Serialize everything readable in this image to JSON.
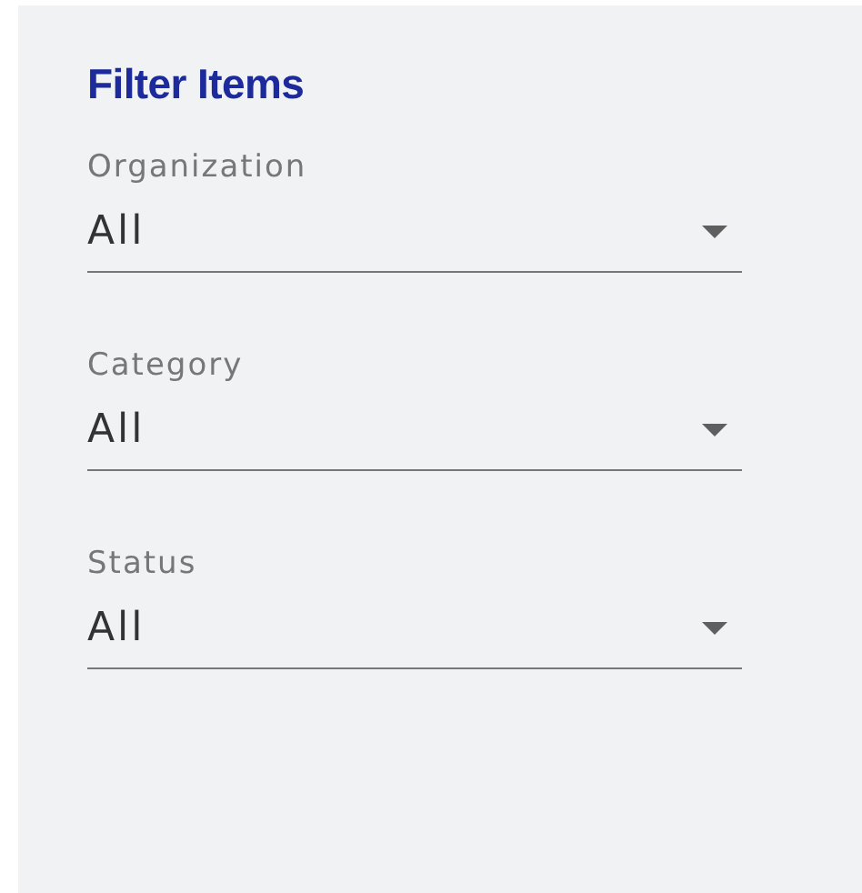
{
  "panel": {
    "title": "Filter Items",
    "filters": [
      {
        "label": "Organization",
        "value": "All"
      },
      {
        "label": "Category",
        "value": "All"
      },
      {
        "label": "Status",
        "value": "All"
      }
    ]
  }
}
